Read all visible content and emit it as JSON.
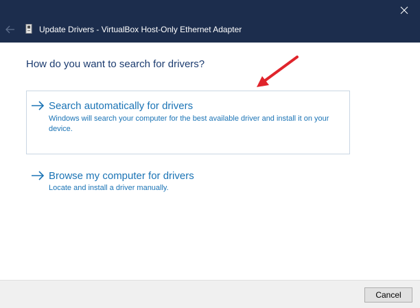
{
  "window": {
    "title": "Update Drivers - VirtualBox Host-Only Ethernet Adapter",
    "icons": {
      "close": "close-icon",
      "back": "back-arrow-icon",
      "device": "device-icon"
    }
  },
  "main": {
    "question": "How do you want to search for drivers?",
    "options": [
      {
        "title": "Search automatically for drivers",
        "description": "Windows will search your computer for the best available driver and install it on your device.",
        "icon": "right-arrow-icon"
      },
      {
        "title": "Browse my computer for drivers",
        "description": "Locate and install a driver manually.",
        "icon": "right-arrow-icon"
      }
    ]
  },
  "annotation": {
    "icon": "red-pointer-arrow",
    "color": "#e0242b"
  },
  "footer": {
    "cancel_label": "Cancel"
  },
  "colors": {
    "titlebar": "#1c2d4d",
    "link": "#1a73b5",
    "heading": "#1b3b6f"
  }
}
